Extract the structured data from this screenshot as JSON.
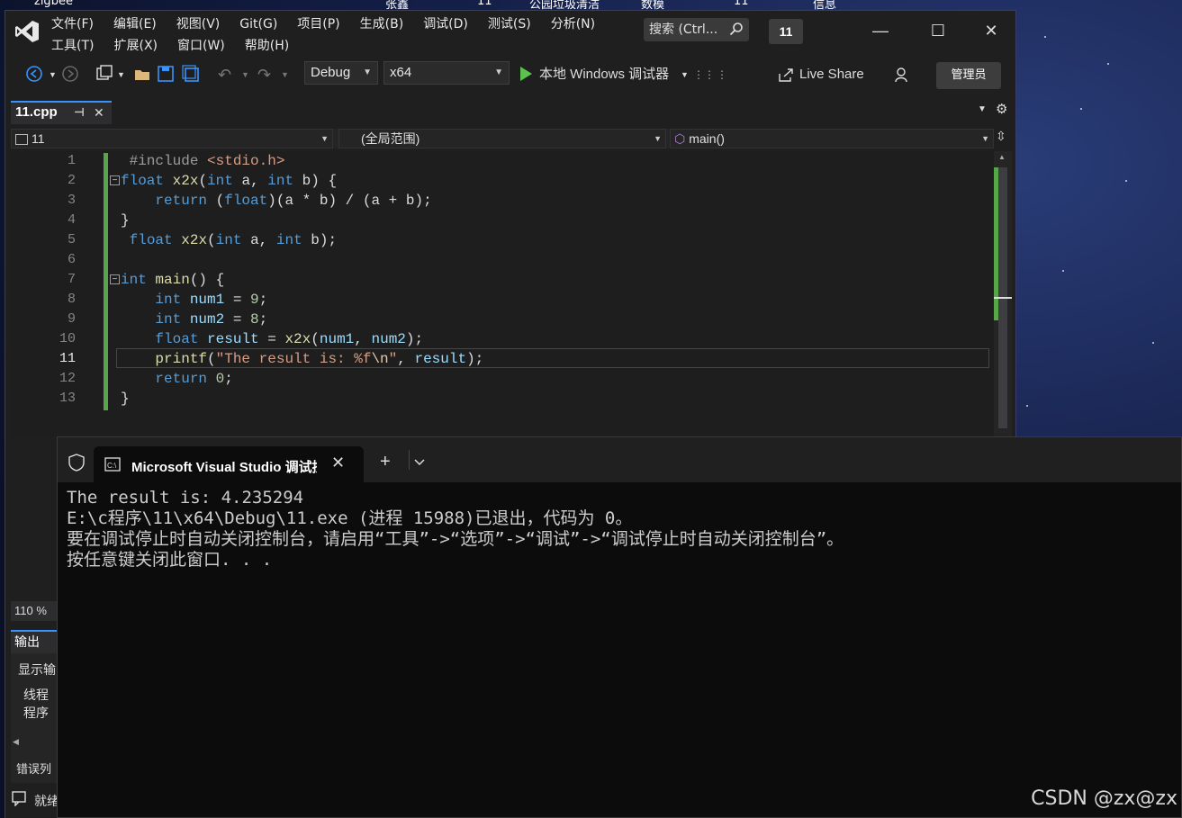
{
  "desktop": {
    "icons": [
      "zigbee",
      "张鑫",
      "11",
      "公园垃圾清洁",
      "数模",
      "11",
      "信息"
    ]
  },
  "titlebar": {
    "menu_row1": [
      "文件(F)",
      "编辑(E)",
      "视图(V)",
      "Git(G)",
      "项目(P)",
      "生成(B)",
      "调试(D)",
      "测试(S)",
      "分析(N)"
    ],
    "menu_row2": [
      "工具(T)",
      "扩展(X)",
      "窗口(W)",
      "帮助(H)"
    ],
    "search_label": "搜索 (Ctrl...",
    "solution_badge": "11",
    "minimize": "—",
    "maximize": "☐",
    "close": "✕"
  },
  "toolbar": {
    "config": "Debug",
    "platform": "x64",
    "run_label": "本地 Windows 调试器",
    "live_share": "Live Share",
    "admin": "管理员"
  },
  "doc_tab": {
    "label": "11.cpp",
    "pin": "⊣",
    "close": "✕"
  },
  "nav_bar": {
    "project": "11",
    "scope": "(全局范围)",
    "member": "main()"
  },
  "editor": {
    "line_numbers": [
      "1",
      "2",
      "3",
      "4",
      "5",
      "6",
      "7",
      "8",
      "9",
      "10",
      "11",
      "12",
      "13"
    ],
    "current_line": 11
  },
  "status": {
    "zoom": "110 %"
  },
  "output": {
    "tab": "输出",
    "show_label": "显示输",
    "line1": "线程",
    "line2": "程序",
    "error_list": "错误列",
    "ready": "就绪"
  },
  "terminal": {
    "tab_title": "Microsoft Visual Studio 调试控制台",
    "lines": [
      "The result is: 4.235294",
      "",
      "E:\\c程序\\11\\x64\\Debug\\11.exe (进程 15988)已退出，代码为 0。",
      "要在调试停止时自动关闭控制台，请启用“工具”->“选项”->“调试”->“调试停止时自动关闭控制台”。",
      "按任意键关闭此窗口. . ."
    ]
  },
  "watermark": "CSDN @zx@zx"
}
